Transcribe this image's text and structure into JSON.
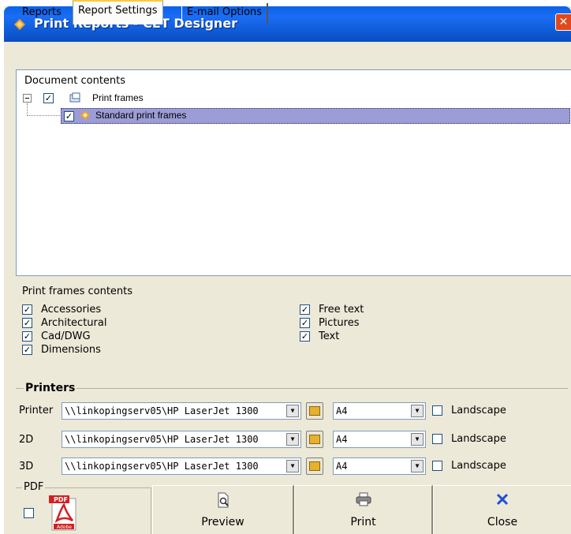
{
  "window": {
    "title": "Print Reports - CET Designer",
    "close_glyph": "✕"
  },
  "tabs": [
    {
      "label": "Reports"
    },
    {
      "label": "Report Settings"
    },
    {
      "label": "E-mail Options"
    }
  ],
  "tree": {
    "root_label": "Document contents",
    "node_label": "Print frames",
    "node_checked": true,
    "child_label": "Standard print frames",
    "child_checked": true
  },
  "print_frames_contents": {
    "heading": "Print frames contents",
    "left": [
      {
        "label": "Accessories",
        "checked": true
      },
      {
        "label": "Architectural",
        "checked": true
      },
      {
        "label": "Cad/DWG",
        "checked": true
      },
      {
        "label": "Dimensions",
        "checked": true
      }
    ],
    "right": [
      {
        "label": "Free text",
        "checked": true
      },
      {
        "label": "Pictures",
        "checked": true
      },
      {
        "label": "Text",
        "checked": true
      }
    ]
  },
  "printers": {
    "legend": "Printers",
    "rows": [
      {
        "label": "Printer",
        "printer": "\\\\linkopingserv05\\HP LaserJet 1300",
        "paper": "A4",
        "landscape_label": "Landscape",
        "landscape": false
      },
      {
        "label": "2D",
        "printer": "\\\\linkopingserv05\\HP LaserJet 1300",
        "paper": "A4",
        "landscape_label": "Landscape",
        "landscape": false
      },
      {
        "label": "3D",
        "printer": "\\\\linkopingserv05\\HP LaserJet 1300",
        "paper": "A4",
        "landscape_label": "Landscape",
        "landscape": false
      }
    ]
  },
  "pdf": {
    "legend": "PDF",
    "checked": false,
    "icon_top_text": "PDF",
    "icon_bottom_text": "Adobe"
  },
  "buttons": {
    "preview": "Preview",
    "print": "Print",
    "close": "Close"
  },
  "colors": {
    "title_bar": "#0a62e8",
    "selection": "#9c9cd6",
    "window_bg": "#ece9d8",
    "close_icon": "#1f4fd6"
  }
}
